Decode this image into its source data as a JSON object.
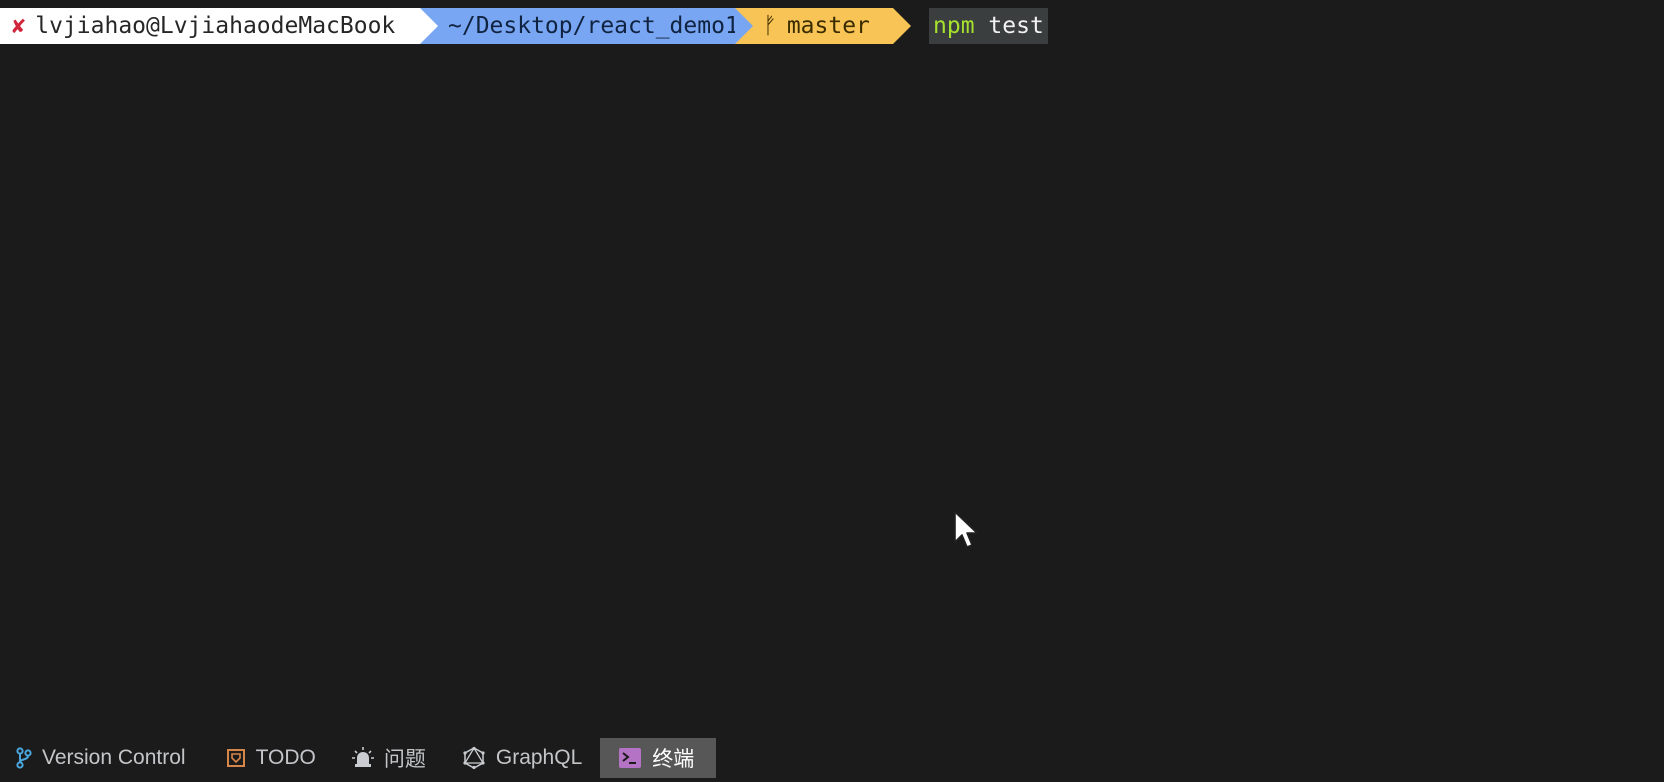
{
  "prompt": {
    "status_glyph": "✘",
    "user_host": "lvjiahao@LvjiahaodeMacBook",
    "path": "~/Desktop/react_demo1",
    "branch_glyph": "ᚠ",
    "branch": "master",
    "command_bin": "npm",
    "command_args": "test",
    "colors": {
      "user_bg": "#ffffff",
      "path_bg": "#79a6f2",
      "git_bg": "#f7c455",
      "status_error": "#d0253b",
      "command_bin": "#a6e22e"
    }
  },
  "toolbar": {
    "items": [
      {
        "label": "Version Control",
        "icon": "branch-icon"
      },
      {
        "label": "TODO",
        "icon": "todo-icon"
      },
      {
        "label": "问题",
        "icon": "alarm-icon"
      },
      {
        "label": "GraphQL",
        "icon": "graphql-icon"
      },
      {
        "label": "终端",
        "icon": "terminal-icon",
        "active": true
      }
    ]
  }
}
